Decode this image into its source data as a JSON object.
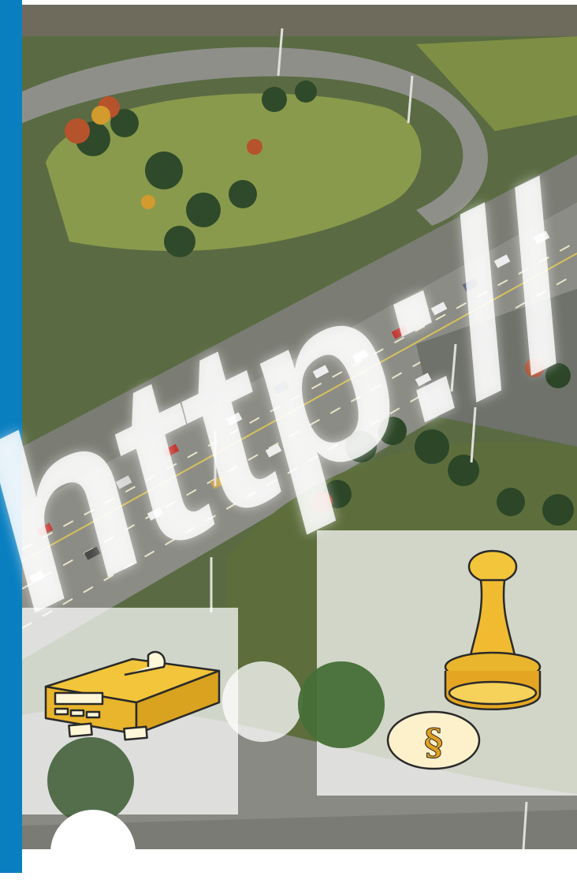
{
  "overlay_text": "http://",
  "icons": [
    "card-terminal-icon",
    "rubber-stamp-icon",
    "paragraph-seal-icon"
  ],
  "stamp_symbol": "§",
  "colors": {
    "side_bar": "#0a7fc0",
    "illustration_fill": "#f3c53a",
    "illustration_outline": "#2a2a2a",
    "panel_overlay": "#ffffff"
  }
}
